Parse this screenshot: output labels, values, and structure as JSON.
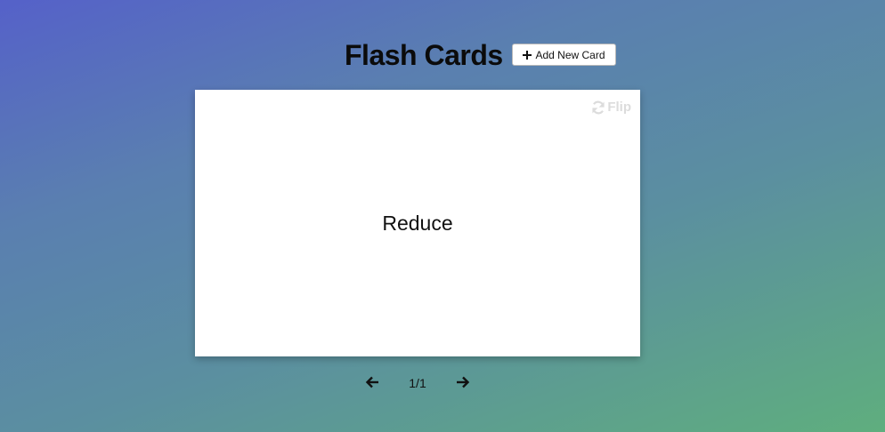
{
  "header": {
    "title": "Flash Cards",
    "add_button_label": "Add New Card"
  },
  "card": {
    "flip_label": "Flip",
    "word": "Reduce"
  },
  "navigation": {
    "counter": "1/1",
    "prev_icon": "arrow-left-icon",
    "next_icon": "arrow-right-icon"
  },
  "colors": {
    "gradient_start": "#5561c9",
    "gradient_end": "#5fae7e",
    "card_background": "#ffffff",
    "flip_color": "#dcdcdc"
  }
}
